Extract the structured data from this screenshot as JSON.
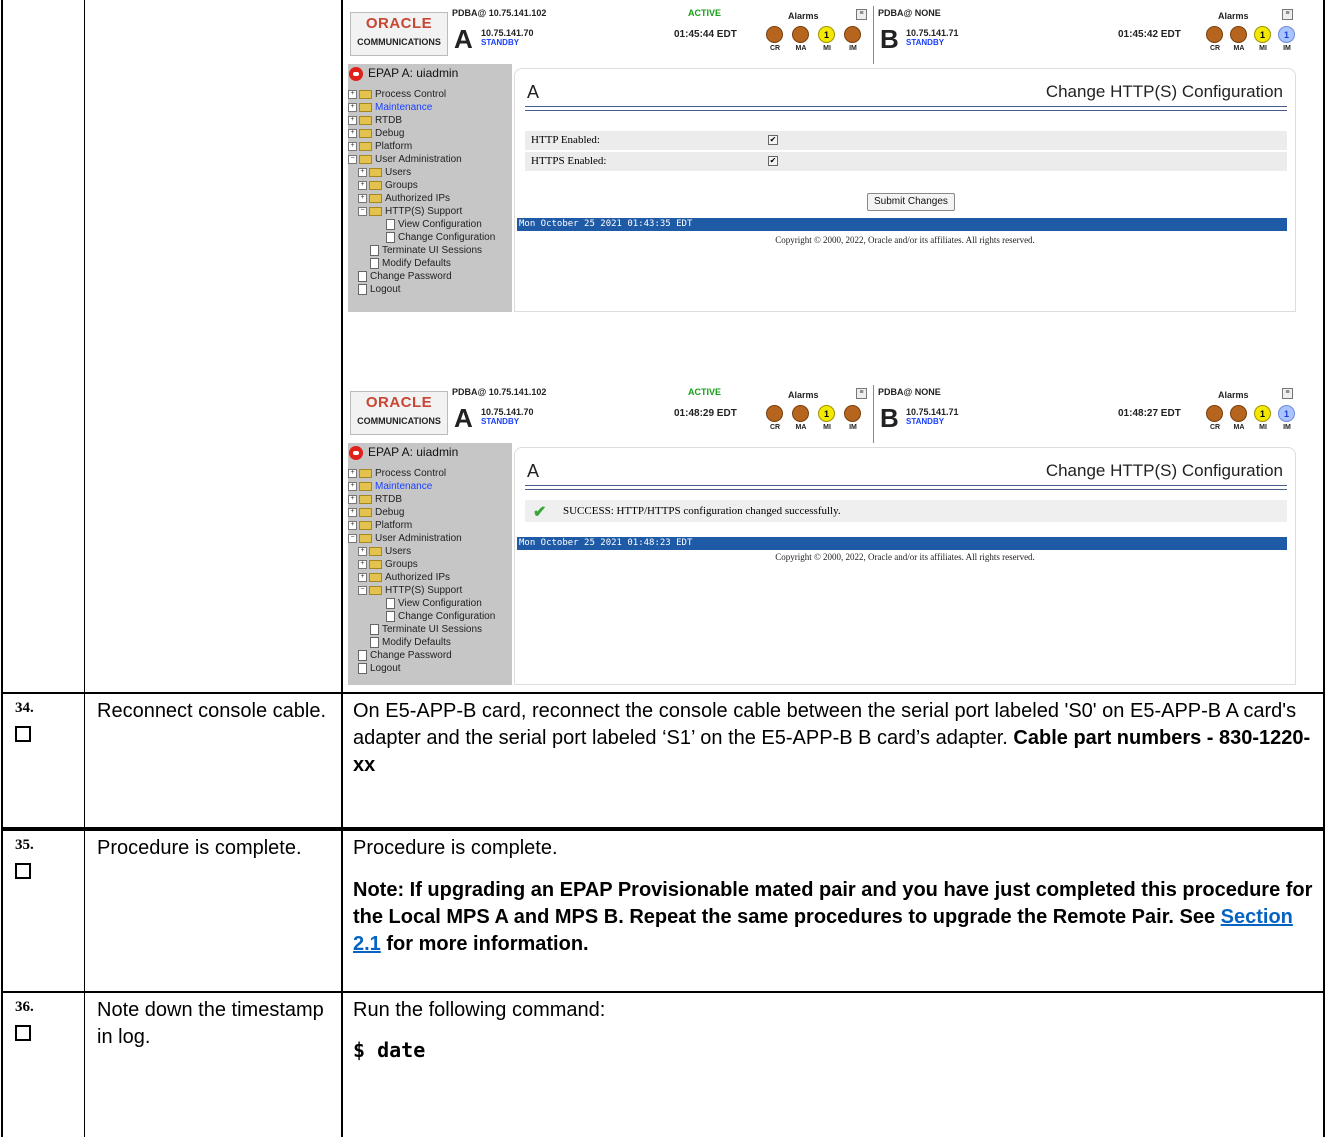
{
  "ui": {
    "logo_top": "ORACLE",
    "logo_bottom": "COMMUNICATIONS",
    "pdba_a": "PDBA@ 10.75.141.102",
    "pdba_b": "PDBA@ NONE",
    "letter_a": "A",
    "letter_b": "B",
    "ip_a": "10.75.141.70",
    "ip_b": "10.75.141.71",
    "standby": "STANDBY",
    "active": "ACTIVE",
    "alarms": "Alarms",
    "alarm_labels": [
      "CR",
      "MA",
      "MI",
      "IM"
    ],
    "alarm_counts": {
      "mi": "1",
      "im": "1"
    },
    "menu_title": "EPAP A: uiadmin",
    "menu": {
      "process_control": "Process Control",
      "maintenance": "Maintenance",
      "rtdb": "RTDB",
      "debug": "Debug",
      "platform": "Platform",
      "user_admin": "User Administration",
      "users": "Users",
      "groups": "Groups",
      "authorized_ips": "Authorized IPs",
      "https_support": "HTTP(S) Support",
      "view_config": "View Configuration",
      "change_config": "Change Configuration",
      "terminate": "Terminate UI Sessions",
      "modify_defaults": "Modify Defaults",
      "change_password": "Change Password",
      "logout": "Logout"
    },
    "page_letter": "A",
    "page_title": "Change HTTP(S) Configuration",
    "copyright": "Copyright © 2000, 2022, Oracle and/or its affiliates. All rights reserved."
  },
  "shot1": {
    "time_a": "01:45:44 EDT",
    "time_b": "01:45:42 EDT",
    "http_label": "HTTP Enabled:",
    "https_label": "HTTPS Enabled:",
    "submit": "Submit Changes",
    "status": "Mon October 25 2021 01:43:35 EDT"
  },
  "shot2": {
    "time_a": "01:48:29 EDT",
    "time_b": "01:48:27 EDT",
    "success": "SUCCESS: HTTP/HTTPS configuration changed successfully.",
    "status": "Mon October 25 2021 01:48:23 EDT"
  },
  "steps": [
    {
      "num": "34.",
      "name": "Reconnect console cable.",
      "text": "On E5-APP-B card, reconnect the console cable between the serial port labeled 'S0' on E5-APP-B A card's adapter and the serial port labeled ‘S1’ on the E5-APP-B B card’s adapter. ",
      "text_bold": "Cable part numbers - 830-1220-xx"
    },
    {
      "num": "35.",
      "name": "Procedure is complete.",
      "text": "Procedure is complete.",
      "note_a": "Note: If upgrading an EPAP Provisionable mated pair and you have just completed this procedure for the Local MPS A and MPS B. Repeat the same procedures to upgrade the Remote Pair. See ",
      "note_link": "Section 2.1",
      "note_b": " for more information."
    },
    {
      "num": "36.",
      "name": "Note down the timestamp in log.",
      "text": "Run the following command:",
      "command": "$ date"
    }
  ]
}
